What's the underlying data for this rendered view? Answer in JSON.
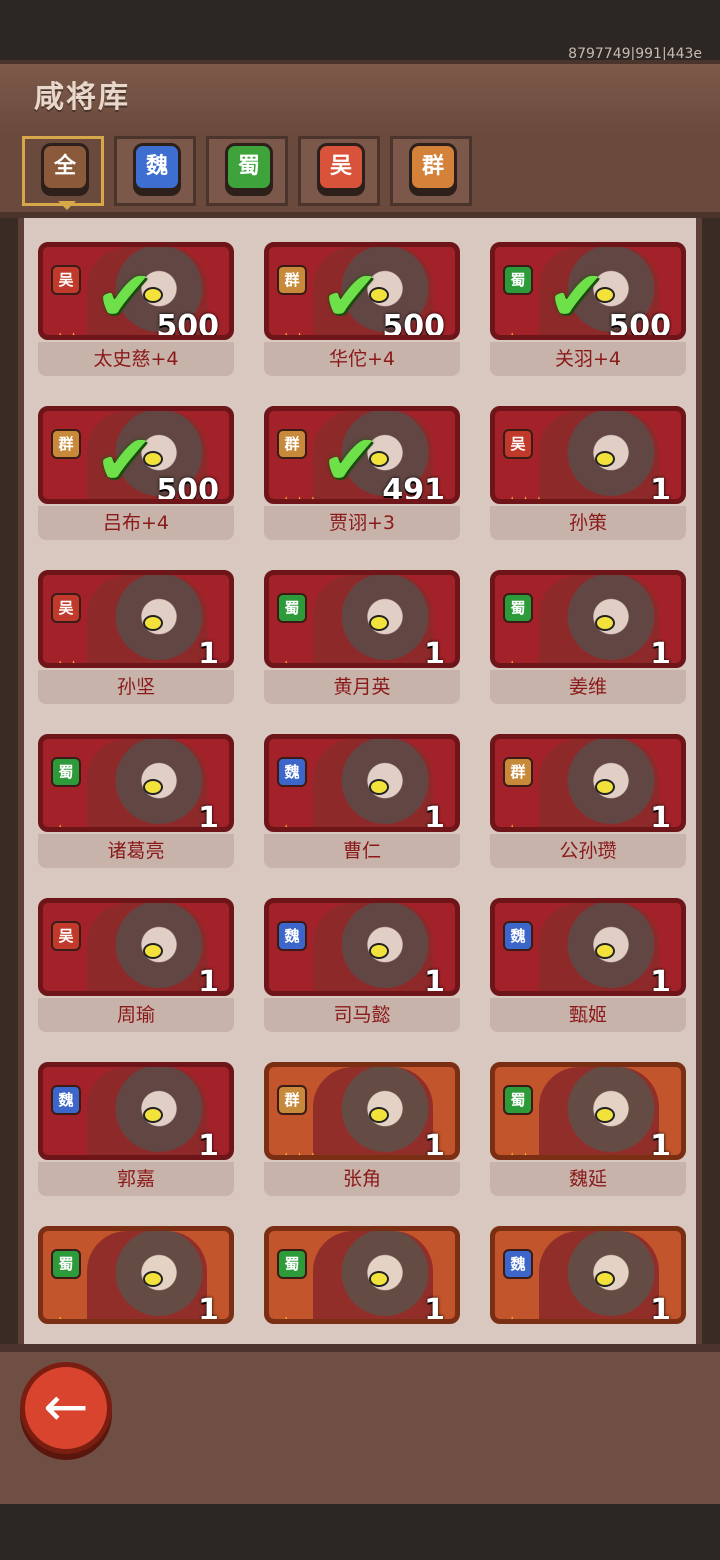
{
  "uid": "8797749|991|443e",
  "title": "咸将库",
  "tabs": [
    {
      "label": "全",
      "color": "#8a5a3a",
      "active": true
    },
    {
      "label": "魏",
      "color": "#3f6ed1",
      "active": false
    },
    {
      "label": "蜀",
      "color": "#3da33a",
      "active": false
    },
    {
      "label": "吴",
      "color": "#d8533a",
      "active": false
    },
    {
      "label": "群",
      "color": "#d4823a",
      "active": false
    }
  ],
  "faction_colors": {
    "吴": "#c0392b",
    "群": "#c88a3a",
    "蜀": "#2e9b3a",
    "魏": "#3c66c9"
  },
  "heroes": [
    {
      "name": "太史慈+4",
      "faction": "吴",
      "stars": "★★",
      "count": "500",
      "checked": true,
      "frame": "red"
    },
    {
      "name": "华佗+4",
      "faction": "群",
      "stars": "★★",
      "count": "500",
      "checked": true,
      "frame": "red"
    },
    {
      "name": "关羽+4",
      "faction": "蜀",
      "stars": "★",
      "count": "500",
      "checked": true,
      "frame": "red"
    },
    {
      "name": "吕布+4",
      "faction": "群",
      "stars": "",
      "count": "500",
      "checked": true,
      "frame": "red"
    },
    {
      "name": "贾诩+3",
      "faction": "群",
      "stars": "★★★",
      "count": "491",
      "checked": true,
      "frame": "red"
    },
    {
      "name": "孙策",
      "faction": "吴",
      "stars": "★★★",
      "count": "1",
      "checked": false,
      "frame": "red"
    },
    {
      "name": "孙坚",
      "faction": "吴",
      "stars": "★★",
      "count": "1",
      "checked": false,
      "frame": "red"
    },
    {
      "name": "黄月英",
      "faction": "蜀",
      "stars": "★",
      "count": "1",
      "checked": false,
      "frame": "red"
    },
    {
      "name": "姜维",
      "faction": "蜀",
      "stars": "★",
      "count": "1",
      "checked": false,
      "frame": "red"
    },
    {
      "name": "诸葛亮",
      "faction": "蜀",
      "stars": "★",
      "count": "1",
      "checked": false,
      "frame": "red"
    },
    {
      "name": "曹仁",
      "faction": "魏",
      "stars": "★",
      "count": "1",
      "checked": false,
      "frame": "red"
    },
    {
      "name": "公孙瓒",
      "faction": "群",
      "stars": "★",
      "count": "1",
      "checked": false,
      "frame": "red"
    },
    {
      "name": "周瑜",
      "faction": "吴",
      "stars": "",
      "count": "1",
      "checked": false,
      "frame": "red"
    },
    {
      "name": "司马懿",
      "faction": "魏",
      "stars": "",
      "count": "1",
      "checked": false,
      "frame": "red"
    },
    {
      "name": "甄姬",
      "faction": "魏",
      "stars": "",
      "count": "1",
      "checked": false,
      "frame": "red"
    },
    {
      "name": "郭嘉",
      "faction": "魏",
      "stars": "",
      "count": "1",
      "checked": false,
      "frame": "red"
    },
    {
      "name": "张角",
      "faction": "群",
      "stars": "★★★",
      "count": "1",
      "checked": false,
      "frame": "orange"
    },
    {
      "name": "魏延",
      "faction": "蜀",
      "stars": "★★",
      "count": "1",
      "checked": false,
      "frame": "orange"
    },
    {
      "name": "",
      "faction": "蜀",
      "stars": "★",
      "count": "1",
      "checked": false,
      "frame": "orange"
    },
    {
      "name": "",
      "faction": "蜀",
      "stars": "★",
      "count": "1",
      "checked": false,
      "frame": "orange"
    },
    {
      "name": "",
      "faction": "魏",
      "stars": "★",
      "count": "1",
      "checked": false,
      "frame": "orange"
    }
  ],
  "back_icon": "back-arrow-icon",
  "check_icon": "checkmark-icon"
}
